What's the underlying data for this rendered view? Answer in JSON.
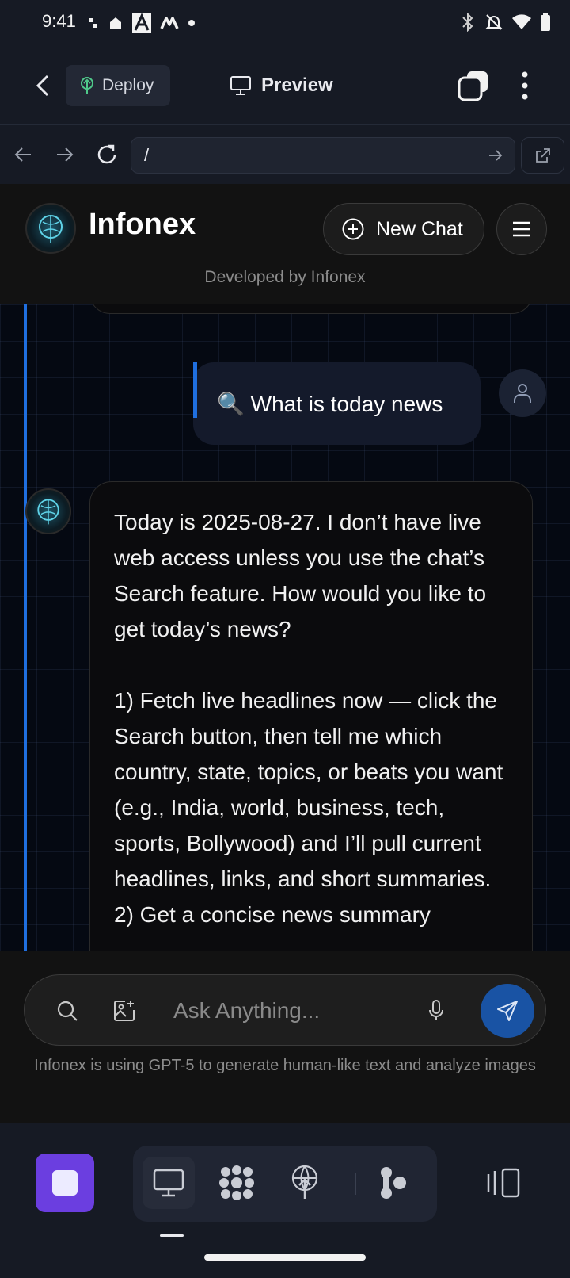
{
  "status_bar": {
    "time": "9:41",
    "left_icons": [
      "dots-icon",
      "home-icon",
      "a-icon",
      "m-icon",
      "dot-icon"
    ],
    "right_icons": [
      "bluetooth-icon",
      "mute-icon",
      "wifi-icon",
      "battery-icon"
    ]
  },
  "toolbar": {
    "deploy_label": "Deploy",
    "preview_label": "Preview"
  },
  "browser": {
    "url": "/"
  },
  "app": {
    "name": "Infonex",
    "new_chat_label": "New Chat",
    "developed_by": "Developed by Infonex"
  },
  "chat": {
    "user_message": "🔍 What is today news",
    "assistant_paragraphs": [
      "Today is 2025-08-27. I don’t have live web access unless you use the chat’s Search feature. How would you like to get today’s news?",
      "1) Fetch live headlines now — click the Search button, then tell me which country, state, topics, or beats you want (e.g., India, world, business, tech, sports, Bollywood) and I’ll pull current headlines, links, and short summaries.",
      "2) Get a concise news summary"
    ]
  },
  "composer": {
    "placeholder": "Ask Anything...",
    "disclaimer": "Infonex is using GPT-5 to generate human-like text and analyze images"
  },
  "dock": {
    "items": [
      "monitor-icon",
      "shapes-icon",
      "deploy-icon",
      "agent-icon"
    ],
    "active_index": 0
  },
  "colors": {
    "accent_blue": "#1f6fe0",
    "send_button": "#1953a4",
    "stop_button": "#6b3ee0",
    "deploy_icon": "#4fc98a"
  }
}
